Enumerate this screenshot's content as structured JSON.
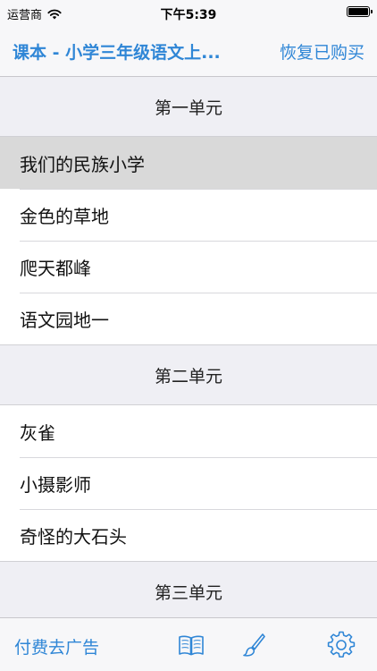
{
  "status_bar": {
    "carrier": "运营商",
    "time": "下午5:39"
  },
  "nav": {
    "title": "课本 - 小学三年级语文上...",
    "restore_label": "恢复已购买"
  },
  "sections": [
    {
      "title": "第一单元",
      "items": [
        "我们的民族小学",
        "金色的草地",
        "爬天都峰",
        "语文园地一"
      ]
    },
    {
      "title": "第二单元",
      "items": [
        "灰雀",
        "小摄影师",
        "奇怪的大石头"
      ]
    },
    {
      "title": "第三单元",
      "items": []
    }
  ],
  "toolbar": {
    "ad_label": "付费去广告"
  },
  "colors": {
    "accent": "#2f86d6",
    "selected_row": "#d9d9d9",
    "background": "#efeff4"
  },
  "icons": {
    "wifi": "wifi-icon",
    "battery": "battery-icon",
    "book": "book-icon",
    "brush": "brush-icon",
    "settings": "gear-icon"
  }
}
